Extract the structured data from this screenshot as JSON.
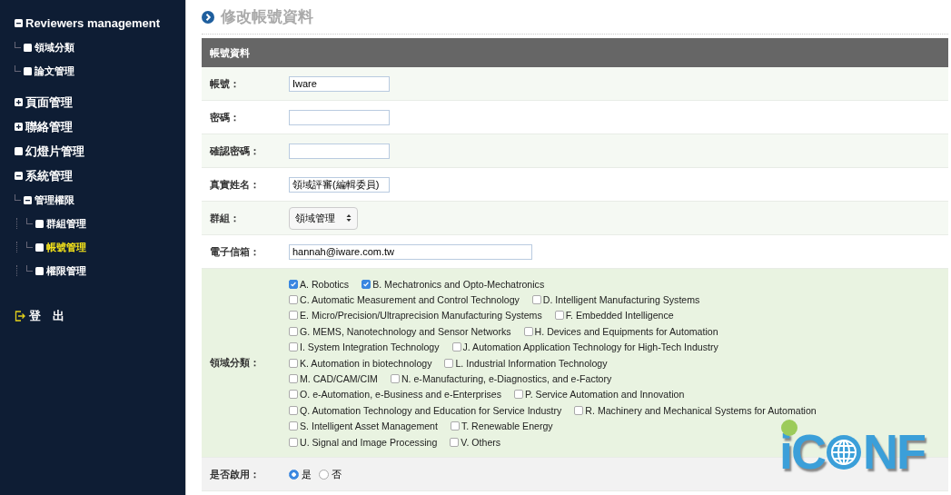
{
  "sidebar": {
    "items": [
      {
        "label": "Reviewers management",
        "expanded": true,
        "selected": false,
        "children": [
          {
            "label": "領域分類",
            "selected": false
          },
          {
            "label": "論文管理",
            "selected": false
          }
        ]
      },
      {
        "label": "頁面管理",
        "expanded": false,
        "selected": false
      },
      {
        "label": "聯絡管理",
        "expanded": false,
        "selected": false
      },
      {
        "label": "幻燈片管理",
        "selected": false
      },
      {
        "label": "系統管理",
        "expanded": true,
        "selected": false,
        "children": [
          {
            "label": "管理權限",
            "expanded": true,
            "selected": false,
            "children": [
              {
                "label": "群組管理",
                "selected": false
              },
              {
                "label": "帳號管理",
                "selected": true
              },
              {
                "label": "權限管理",
                "selected": false
              }
            ]
          }
        ]
      }
    ],
    "logout": "登　出"
  },
  "page_title": "修改帳號資料",
  "form": {
    "header": "帳號資料",
    "fields": [
      {
        "kind": "text",
        "label": "帳號：",
        "value": "Iware"
      },
      {
        "kind": "password",
        "label": "密碼："
      },
      {
        "kind": "password",
        "label": "確認密碼："
      },
      {
        "kind": "text",
        "label": "真實姓名：",
        "value": "領域評審(編輯委員)"
      },
      {
        "kind": "select",
        "label": "群組：",
        "value": "領域管理"
      },
      {
        "kind": "email",
        "label": "電子信箱：",
        "value": "hannah@iware.com.tw"
      },
      {
        "kind": "checkboxes",
        "label": "領域分類：",
        "lines": [
          [
            {
              "label": "A. Robotics",
              "checked": true
            },
            {
              "label": "B. Mechatronics and Opto-Mechatronics",
              "checked": true
            }
          ],
          [
            {
              "label": "C. Automatic Measurement and Control Technology",
              "checked": false
            },
            {
              "label": "D. Intelligent Manufacturing Systems",
              "checked": false
            }
          ],
          [
            {
              "label": "E. Micro/Precision/Ultraprecision Manufacturing Systems",
              "checked": false
            },
            {
              "label": "F. Embedded Intelligence",
              "checked": false
            }
          ],
          [
            {
              "label": "G. MEMS, Nanotechnology and Sensor Networks",
              "checked": false
            },
            {
              "label": "H. Devices and Equipments for Automation",
              "checked": false
            }
          ],
          [
            {
              "label": "I. System Integration Technology",
              "checked": false
            },
            {
              "label": "J. Automation Application Technology for High-Tech Industry",
              "checked": false
            }
          ],
          [
            {
              "label": "K. Automation in biotechnology",
              "checked": false
            },
            {
              "label": "L. Industrial Information Technology",
              "checked": false
            }
          ],
          [
            {
              "label": "M. CAD/CAM/CIM",
              "checked": false
            },
            {
              "label": "N. e-Manufacturing, e-Diagnostics, and e-Factory",
              "checked": false
            }
          ],
          [
            {
              "label": "O. e-Automation, e-Business and e-Enterprises",
              "checked": false
            },
            {
              "label": "P. Service Automation and Innovation",
              "checked": false
            }
          ],
          [
            {
              "label": "Q. Automation Technology and Education for Service Industry",
              "checked": false
            },
            {
              "label": "R. Machinery and Mechanical Systems for Automation",
              "checked": false
            }
          ],
          [
            {
              "label": "S. Intelligent Asset Management",
              "checked": false
            },
            {
              "label": "T. Renewable Energy",
              "checked": false
            }
          ],
          [
            {
              "label": "U. Signal and Image Processing",
              "checked": false
            },
            {
              "label": "V. Others",
              "checked": false
            }
          ]
        ]
      },
      {
        "kind": "radios",
        "label": "是否啟用：",
        "options": [
          {
            "label": "是",
            "selected": true
          },
          {
            "label": "否",
            "selected": false
          }
        ]
      }
    ]
  },
  "logo": {
    "text_before": "iC",
    "text_after": "NF"
  }
}
